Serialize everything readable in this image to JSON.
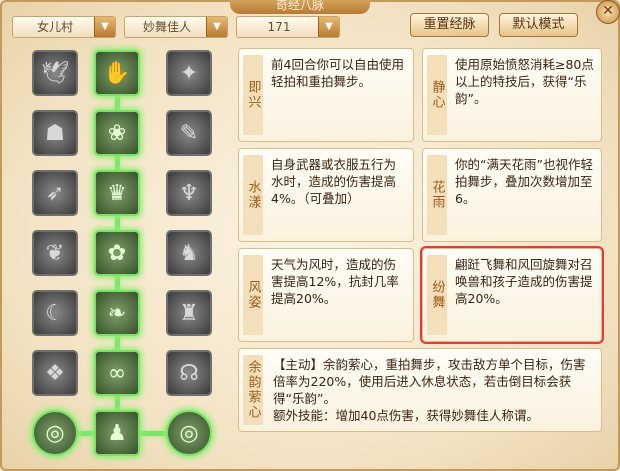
{
  "window": {
    "title": "奇经八脉"
  },
  "filters": {
    "school": "女儿村",
    "skill": "妙舞佳人",
    "points": "171"
  },
  "buttons": {
    "reset": "重置经脉",
    "default": "默认模式"
  },
  "talents": [
    {
      "label": "即兴",
      "desc": "前4回合你可以自由使用轻拍和重拍舞步。"
    },
    {
      "label": "静心",
      "desc": "使用原始愤怒消耗≥80点以上的特技后，获得“乐韵”。"
    },
    {
      "label": "水漾",
      "desc": "自身武器或衣服五行为水时，造成的伤害提高4%。（可叠加）"
    },
    {
      "label": "花雨",
      "desc": "你的“满天花雨”也视作轻拍舞步，叠加次数增加至6。"
    },
    {
      "label": "风姿",
      "desc": "天气为风时，造成的伤害提高12%，抗封几率提高20%。"
    },
    {
      "label": "纷舞",
      "desc": "翩跹飞舞和风回旋舞对召唤兽和孩子造成的伤害提高20%。"
    }
  ],
  "ultimate": {
    "label": "余韵萦心",
    "desc": "【主动】余韵萦心，重拍舞步，攻击敌方单个目标，伤害倍率为220%，使用后进入休息状态，若击倒目标会获得“乐韵”。",
    "extra": "额外技能：增加40点伤害，获得妙舞佳人称谓。"
  },
  "icons": [
    "wings-icon",
    "hand-icon",
    "star-icon",
    "hood-icon",
    "lotus-icon",
    "quill-icon",
    "bird-icon",
    "crown-icon",
    "phoenix-icon",
    "rabbit-icon",
    "flower-icon",
    "lion-icon",
    "moon-icon",
    "leaf-icon",
    "cat-icon",
    "cube-icon",
    "swirl-icon",
    "dragon-icon",
    "orb-icon",
    "dancer-icon",
    "orb-icon"
  ]
}
